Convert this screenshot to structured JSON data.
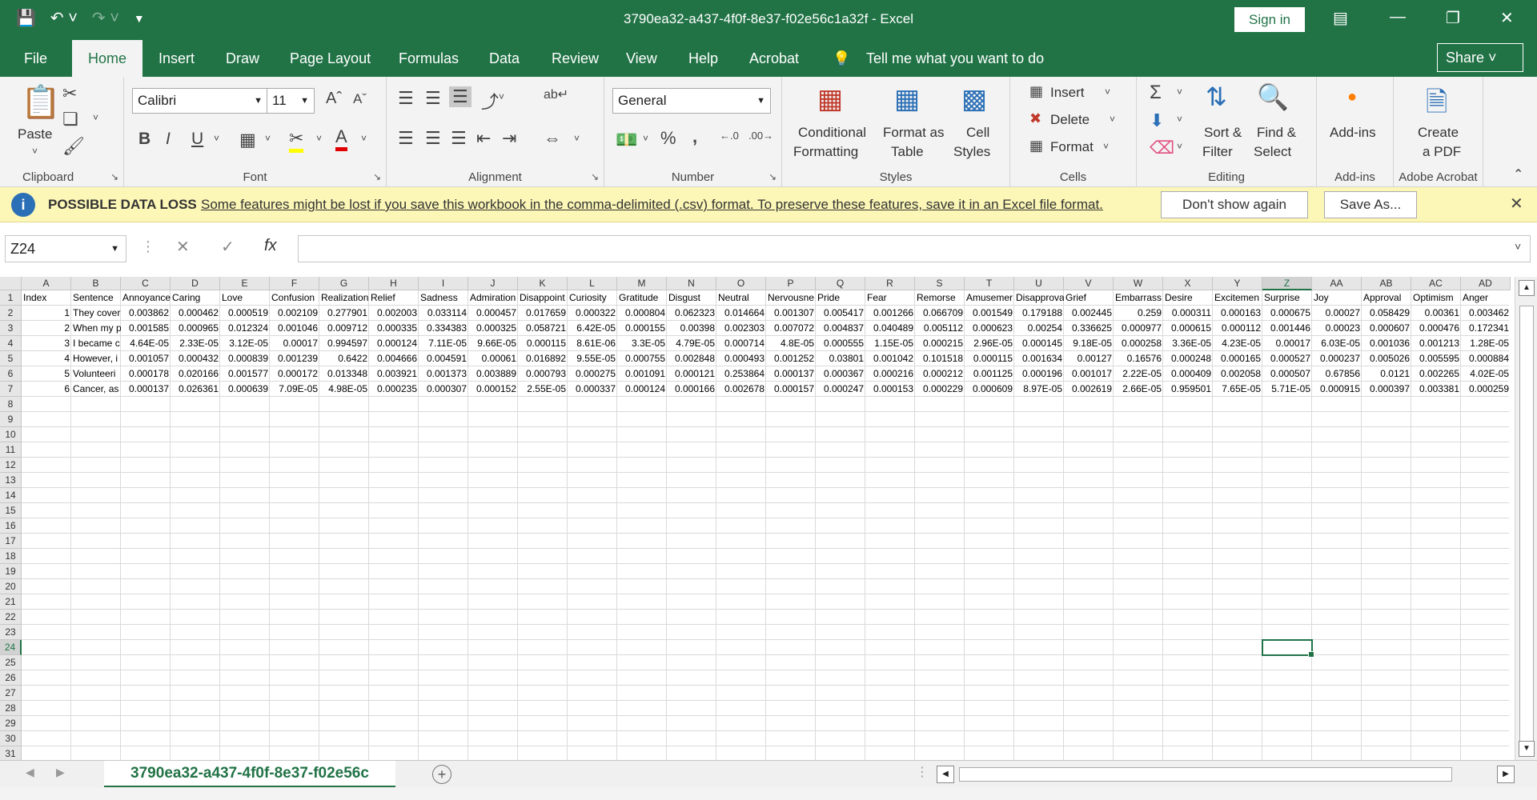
{
  "titlebar": {
    "title": "3790ea32-a437-4f0f-8e37-f02e56c1a32f  -  Excel",
    "sign_in": "Sign in",
    "qat_icons": [
      "save-icon",
      "undo-icon",
      "redo-icon",
      "customize-qat-icon"
    ]
  },
  "tabs": [
    {
      "label": "File"
    },
    {
      "label": "Home"
    },
    {
      "label": "Insert"
    },
    {
      "label": "Draw"
    },
    {
      "label": "Page Layout"
    },
    {
      "label": "Formulas"
    },
    {
      "label": "Data"
    },
    {
      "label": "Review"
    },
    {
      "label": "View"
    },
    {
      "label": "Help"
    },
    {
      "label": "Acrobat"
    }
  ],
  "tell_me": "Tell me what you want to do",
  "share": "Share",
  "ribbon": {
    "clipboard": {
      "label": "Clipboard",
      "paste": "Paste"
    },
    "font": {
      "label": "Font",
      "name": "Calibri",
      "size": "11"
    },
    "alignment": {
      "label": "Alignment"
    },
    "number": {
      "label": "Number",
      "format": "General",
      "pct": "%",
      "comma": ","
    },
    "styles": {
      "label": "Styles",
      "conditional1": "Conditional",
      "conditional2": "Formatting",
      "format_table1": "Format as",
      "format_table2": "Table",
      "cell_styles1": "Cell",
      "cell_styles2": "Styles"
    },
    "cells": {
      "label": "Cells",
      "insert": "Insert",
      "delete": "Delete",
      "format": "Format"
    },
    "editing": {
      "label": "Editing",
      "sort1": "Sort &",
      "sort2": "Filter",
      "find1": "Find &",
      "find2": "Select"
    },
    "addins": {
      "label": "Add-ins",
      "btn": "Add-ins"
    },
    "acrobat": {
      "label": "Adobe Acrobat",
      "create1": "Create",
      "create2": "a PDF"
    }
  },
  "message_bar": {
    "title": "POSSIBLE DATA LOSS",
    "text": "Some features might be lost if you save this workbook in the comma-delimited (.csv) format. To preserve these features, save it in an Excel file format.",
    "dont_show": "Don't show again",
    "save_as": "Save As..."
  },
  "formula_bar": {
    "name_box": "Z24",
    "fx": "fx",
    "value": ""
  },
  "grid": {
    "columns": [
      "A",
      "B",
      "C",
      "D",
      "E",
      "F",
      "G",
      "H",
      "I",
      "J",
      "K",
      "L",
      "M",
      "N",
      "O",
      "P",
      "Q",
      "R",
      "S",
      "T",
      "U",
      "V",
      "W",
      "X",
      "Y",
      "Z",
      "AA",
      "AB",
      "AC",
      "AD"
    ],
    "selected_column": "Z",
    "selected_row": 24,
    "row_count": 31,
    "header_row": [
      "Index",
      "Sentence",
      "Annoyance",
      "Caring",
      "Love",
      "Confusion",
      "Realization",
      "Relief",
      "Sadness",
      "Admiration",
      "Disappoint",
      "Curiosity",
      "Gratitude",
      "Disgust",
      "Neutral",
      "Nervousne",
      "Pride",
      "Fear",
      "Remorse",
      "Amusemer",
      "Disapprova",
      "Grief",
      "Embarrass",
      "Desire",
      "Excitemen",
      "Surprise",
      "Joy",
      "Approval",
      "Optimism",
      "Anger"
    ],
    "data_rows": [
      [
        "1",
        "They cover",
        "0.003862",
        "0.000462",
        "0.000519",
        "0.002109",
        "0.277901",
        "0.002003",
        "0.033114",
        "0.000457",
        "0.017659",
        "0.000322",
        "0.000804",
        "0.062323",
        "0.014664",
        "0.001307",
        "0.005417",
        "0.001266",
        "0.066709",
        "0.001549",
        "0.179188",
        "0.002445",
        "0.259",
        "0.000311",
        "0.000163",
        "0.000675",
        "0.00027",
        "0.058429",
        "0.00361",
        "0.003462"
      ],
      [
        "2",
        "When my p",
        "0.001585",
        "0.000965",
        "0.012324",
        "0.001046",
        "0.009712",
        "0.000335",
        "0.334383",
        "0.000325",
        "0.058721",
        "6.42E-05",
        "0.000155",
        "0.00398",
        "0.002303",
        "0.007072",
        "0.004837",
        "0.040489",
        "0.005112",
        "0.000623",
        "0.00254",
        "0.336625",
        "0.000977",
        "0.000615",
        "0.000112",
        "0.001446",
        "0.00023",
        "0.000607",
        "0.000476",
        "0.172341"
      ],
      [
        "3",
        "I became c",
        "4.64E-05",
        "2.33E-05",
        "3.12E-05",
        "0.00017",
        "0.994597",
        "0.000124",
        "7.11E-05",
        "9.66E-05",
        "0.000115",
        "8.61E-06",
        "3.3E-05",
        "4.79E-05",
        "0.000714",
        "4.8E-05",
        "0.000555",
        "1.15E-05",
        "0.000215",
        "2.96E-05",
        "0.000145",
        "9.18E-05",
        "0.000258",
        "3.36E-05",
        "4.23E-05",
        "0.00017",
        "6.03E-05",
        "0.001036",
        "0.001213",
        "1.28E-05"
      ],
      [
        "4",
        "However, i",
        "0.001057",
        "0.000432",
        "0.000839",
        "0.001239",
        "0.6422",
        "0.004666",
        "0.004591",
        "0.00061",
        "0.016892",
        "9.55E-05",
        "0.000755",
        "0.002848",
        "0.000493",
        "0.001252",
        "0.03801",
        "0.001042",
        "0.101518",
        "0.000115",
        "0.001634",
        "0.00127",
        "0.16576",
        "0.000248",
        "0.000165",
        "0.000527",
        "0.000237",
        "0.005026",
        "0.005595",
        "0.000884"
      ],
      [
        "5",
        "Volunteeri",
        "0.000178",
        "0.020166",
        "0.001577",
        "0.000172",
        "0.013348",
        "0.003921",
        "0.001373",
        "0.003889",
        "0.000793",
        "0.000275",
        "0.001091",
        "0.000121",
        "0.253864",
        "0.000137",
        "0.000367",
        "0.000216",
        "0.000212",
        "0.001125",
        "0.000196",
        "0.001017",
        "2.22E-05",
        "0.000409",
        "0.002058",
        "0.000507",
        "0.67856",
        "0.0121",
        "0.002265",
        "4.02E-05"
      ],
      [
        "6",
        "Cancer, as",
        "0.000137",
        "0.026361",
        "0.000639",
        "7.09E-05",
        "4.98E-05",
        "0.000235",
        "0.000307",
        "0.000152",
        "2.55E-05",
        "0.000337",
        "0.000124",
        "0.000166",
        "0.002678",
        "0.000157",
        "0.000247",
        "0.000153",
        "0.000229",
        "0.000609",
        "8.97E-05",
        "0.002619",
        "2.66E-05",
        "0.959501",
        "7.65E-05",
        "5.71E-05",
        "0.000915",
        "0.000397",
        "0.003381",
        "0.000259"
      ]
    ]
  },
  "sheet_tab": "3790ea32-a437-4f0f-8e37-f02e56c",
  "add_sheet": "+"
}
